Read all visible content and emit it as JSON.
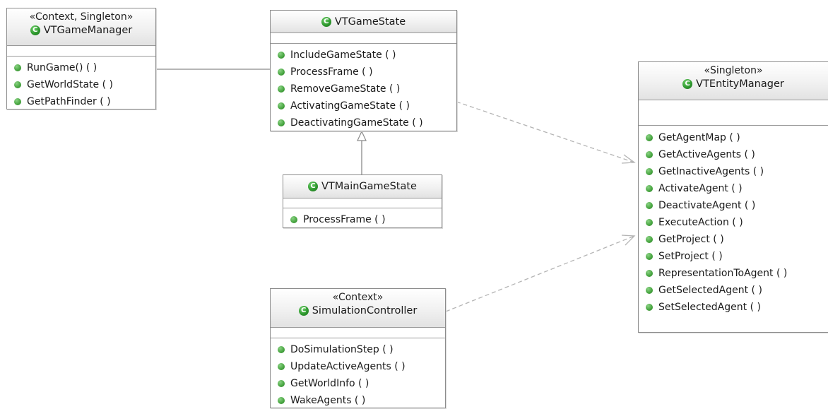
{
  "diagram": {
    "classes": [
      {
        "id": "vtgamemanager",
        "stereotype": "«Context, Singleton»",
        "name": "VTGameManager",
        "icon": "class-icon",
        "operations": [
          "RunGame() ( )",
          "GetWorldState ( )",
          "GetPathFinder ( )"
        ]
      },
      {
        "id": "vtgamestate",
        "stereotype": "",
        "name": "VTGameState",
        "icon": "class-icon",
        "operations": [
          "IncludeGameState ( )",
          "ProcessFrame ( )",
          "RemoveGameState ( )",
          "ActivatingGameState ( )",
          "DeactivatingGameState ( )"
        ]
      },
      {
        "id": "vtmaingamestate",
        "stereotype": "",
        "name": "VTMainGameState",
        "icon": "class-icon",
        "operations": [
          "ProcessFrame ( )"
        ]
      },
      {
        "id": "simulationcontroller",
        "stereotype": "«Context»",
        "name": "SimulationController",
        "icon": "class-icon",
        "operations": [
          "DoSimulationStep ( )",
          "UpdateActiveAgents ( )",
          "GetWorldInfo ( )",
          "WakeAgents ( )"
        ]
      },
      {
        "id": "vtentitymanager",
        "stereotype": "«Singleton»",
        "name": "VTEntityManager",
        "icon": "class-icon",
        "operations": [
          "GetAgentMap ( )",
          "GetActiveAgents ( )",
          "GetInactiveAgents ( )",
          "ActivateAgent ( )",
          "DeactivateAgent ( )",
          "ExecuteAction ( )",
          "GetProject ( )",
          "SetProject ( )",
          "RepresentationToAgent ( )",
          "GetSelectedAgent ( )",
          "SetSelectedAgent ( )"
        ]
      }
    ],
    "relations": [
      {
        "from": "vtgamemanager",
        "to": "vtgamestate",
        "type": "association"
      },
      {
        "from": "vtmaingamestate",
        "to": "vtgamestate",
        "type": "generalization"
      },
      {
        "from": "vtgamestate",
        "to": "vtentitymanager",
        "type": "dependency"
      },
      {
        "from": "simulationcontroller",
        "to": "vtentitymanager",
        "type": "dependency"
      }
    ],
    "colors": {
      "border": "#8c8c8c",
      "header_gradient_end": "#e2e2e2",
      "icon_green": "#2f9a2f",
      "connector": "#9a9a9a",
      "dependency": "#b4b4b4"
    }
  }
}
